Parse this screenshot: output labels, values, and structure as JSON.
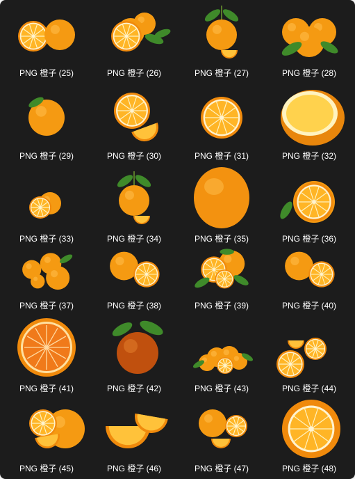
{
  "files": [
    {
      "label": "PNG 橙子 (25)",
      "icon": "two-oranges-halved"
    },
    {
      "label": "PNG 橙子 (26)",
      "icon": "oranges-with-half"
    },
    {
      "label": "PNG 橙子 (27)",
      "icon": "orange-on-stem"
    },
    {
      "label": "PNG 橙子 (28)",
      "icon": "orange-pile"
    },
    {
      "label": "PNG 橙子 (29)",
      "icon": "single-orange"
    },
    {
      "label": "PNG 橙子 (30)",
      "icon": "orange-slices"
    },
    {
      "label": "PNG 橙子 (31)",
      "icon": "orange-cross-section"
    },
    {
      "label": "PNG 橙子 (32)",
      "icon": "orange-half-large"
    },
    {
      "label": "PNG 橙子 (33)",
      "icon": "small-orange-half"
    },
    {
      "label": "PNG 橙子 (34)",
      "icon": "orange-on-stem"
    },
    {
      "label": "PNG 橙子 (35)",
      "icon": "large-orange"
    },
    {
      "label": "PNG 橙子 (36)",
      "icon": "orange-half-with-leaf"
    },
    {
      "label": "PNG 橙子 (37)",
      "icon": "tangerine-group"
    },
    {
      "label": "PNG 橙子 (38)",
      "icon": "orange-and-half"
    },
    {
      "label": "PNG 橙子 (39)",
      "icon": "orange-group-leaves"
    },
    {
      "label": "PNG 橙子 (40)",
      "icon": "orange-and-half"
    },
    {
      "label": "PNG 橙子 (41)",
      "icon": "blood-orange-slice"
    },
    {
      "label": "PNG 橙子 (42)",
      "icon": "dark-orange-with-leaves"
    },
    {
      "label": "PNG 橙子 (43)",
      "icon": "orange-row"
    },
    {
      "label": "PNG 橙子 (44)",
      "icon": "orange-and-slices"
    },
    {
      "label": "PNG 橙子 (45)",
      "icon": "orange-wedges"
    },
    {
      "label": "PNG 橙子 (46)",
      "icon": "peeled-tangerines"
    },
    {
      "label": "PNG 橙子 (47)",
      "icon": "tangerine-and-slice"
    },
    {
      "label": "PNG 橙子 (48)",
      "icon": "orange-cut-large"
    }
  ],
  "colors": {
    "background": "#1c1c1c",
    "label_text": "#ffffff",
    "peel": "#f59a12",
    "flesh": "#ffb526",
    "leaf": "#3f8a2a"
  }
}
